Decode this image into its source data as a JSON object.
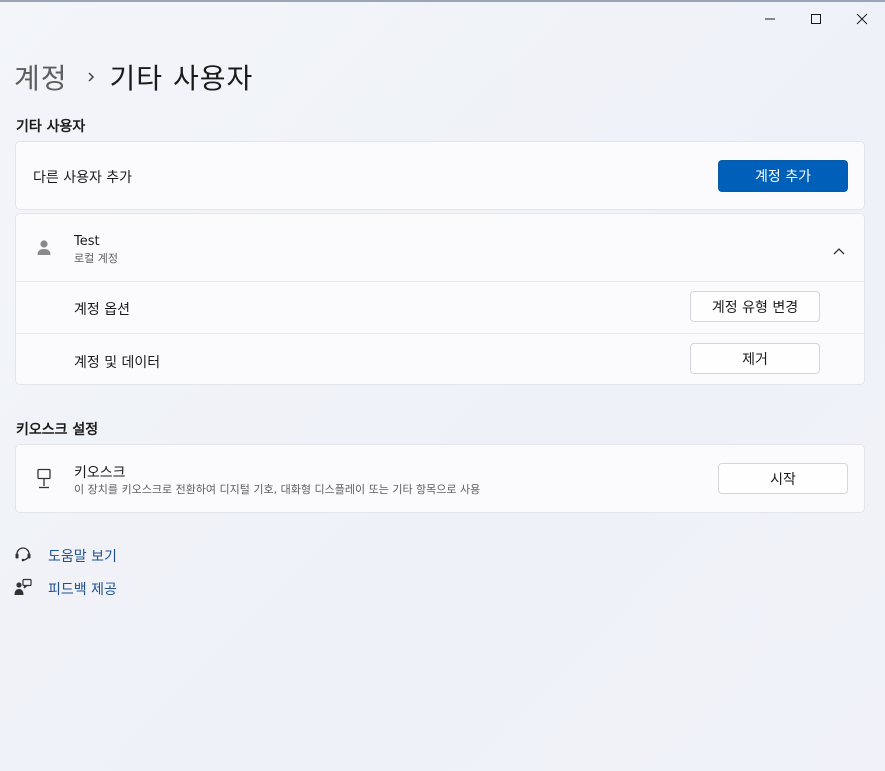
{
  "breadcrumb": {
    "parent": "계정",
    "current": "기타 사용자"
  },
  "other_users": {
    "section_title": "기타 사용자",
    "add_label": "다른 사용자 추가",
    "add_button": "계정 추가",
    "user": {
      "name": "Test",
      "type": "로컬 계정",
      "options_label": "계정 옵션",
      "change_type_button": "계정 유형 변경",
      "data_label": "계정 및 데이터",
      "remove_button": "제거"
    }
  },
  "kiosk": {
    "section_title": "키오스크 설정",
    "title": "키오스크",
    "description": "이 장치를 키오스크로 전환하여 디지털 기호, 대화형 디스플레이 또는 기타 항목으로 사용",
    "start_button": "시작"
  },
  "help": {
    "get_help": "도움말 보기",
    "feedback": "피드백 제공"
  },
  "colors": {
    "accent": "#005fb8",
    "link": "#1f4f8e"
  }
}
